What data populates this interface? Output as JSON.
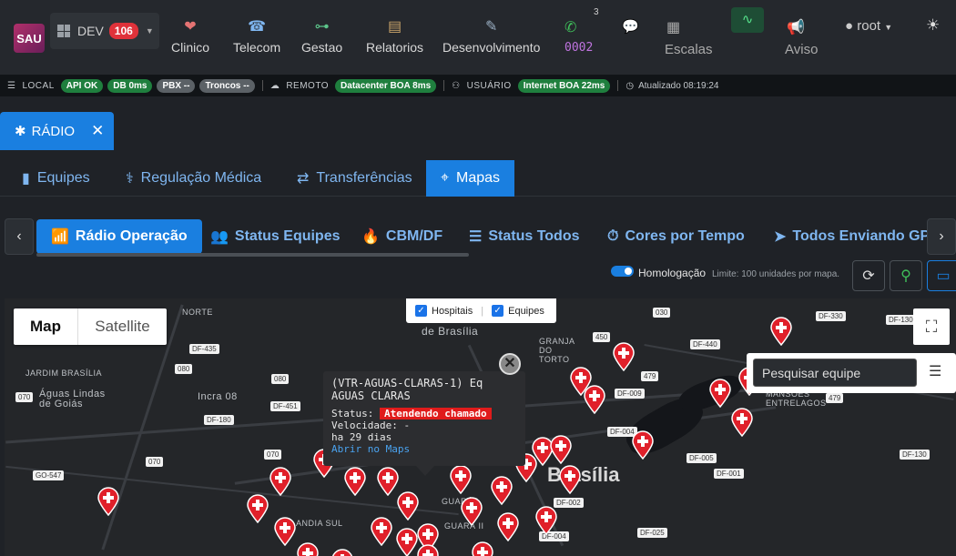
{
  "header": {
    "logo": "SAU",
    "env_label": "DEV",
    "env_badge": "106",
    "nav": [
      {
        "label": "Clinico",
        "icon": "heart-icon"
      },
      {
        "label": "Telecom",
        "icon": "telephone-icon"
      },
      {
        "label": "Gestao",
        "icon": "sitemap-icon"
      },
      {
        "label": "Relatorios",
        "icon": "book-icon"
      },
      {
        "label": "Desenvolvimento",
        "icon": "wrench-icon"
      }
    ],
    "phone_count": "3",
    "phone_number": "0002",
    "escalas": "Escalas",
    "aviso": "Aviso",
    "user": "root"
  },
  "status_bar": {
    "local_label": "LOCAL",
    "api": "API OK",
    "db": "DB 0ms",
    "pbx": "PBX --",
    "troncos": "Troncos --",
    "remoto_label": "REMOTO",
    "datacenter": "Datacenter BOA 8ms",
    "usuario_label": "USUÁRIO",
    "internet": "Internet BOA 22ms",
    "updated": "Atualizado 08:19:24"
  },
  "main_tab": {
    "label": "RÁDIO"
  },
  "subtabs": [
    "Equipes",
    "Regulação Médica",
    "Transferências",
    "Mapas"
  ],
  "chips": [
    "Rádio Operação",
    "Status Equipes",
    "CBM/DF",
    "Status Todos",
    "Cores por Tempo",
    "Todos Enviando GPS"
  ],
  "controls": {
    "toggle_label": "Homologação",
    "toggle_on": true,
    "limit_text": "Limite: 100 unidades por mapa."
  },
  "map": {
    "map_type": [
      "Map",
      "Satellite"
    ],
    "layers": [
      {
        "label": "Hospitais",
        "checked": true
      },
      {
        "label": "Equipes",
        "checked": true
      }
    ],
    "search_placeholder": "Pesquisar equipe",
    "places": [
      "NORTE",
      "de Brasília",
      "GRANJA DO TORTO",
      "JARDIM BRASÍLIA",
      "Águas Lindas de Goiás",
      "Incra 08",
      "MANSÕES ENTRELAGOS",
      "Brasília",
      "GUARÁ I",
      "GUARÁ II",
      "ANDIA SUL"
    ],
    "route_shields": [
      "DF-435",
      "080",
      "070",
      "080",
      "DF-451",
      "DF-180",
      "070",
      "070",
      "GO-547",
      "450",
      "030",
      "DF-440",
      "479",
      "DF-009",
      "DF-004",
      "DF-005",
      "DF-001",
      "DF-002",
      "DF-004",
      "DF-025",
      "DF-330",
      "DF-130",
      "DF-130",
      "479"
    ],
    "popup": {
      "title": "(VTR-AGUAS-CLARAS-1) Eq AGUAS CLARAS",
      "status_label": "Status:",
      "status_value": "Atendendo chamado",
      "speed": "Velocidade: -",
      "time": "ha 29 dias",
      "link": "Abrir no Maps"
    }
  },
  "colors": {
    "accent": "#1a7fe0",
    "ok": "#1f7f3e",
    "pin": "#e0202a"
  }
}
